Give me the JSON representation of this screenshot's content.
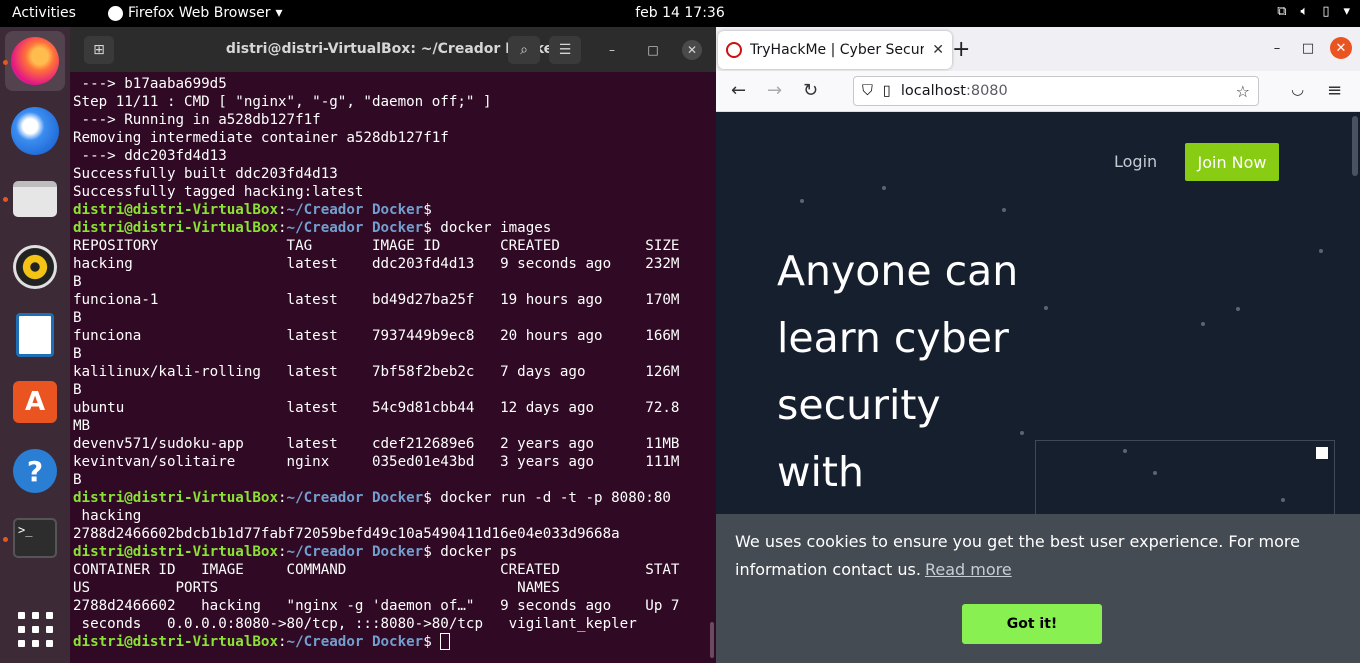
{
  "topbar": {
    "activities": "Activities",
    "app_name": "Firefox Web Browser",
    "clock": "feb 14  17:36",
    "tray_icons": [
      "network-icon",
      "volume-icon",
      "battery-icon",
      "power-menu-icon"
    ]
  },
  "dock": {
    "items": [
      "firefox",
      "thunderbird",
      "files",
      "rhythmbox",
      "libreoffice-writer",
      "software-center",
      "help",
      "terminal",
      "show-applications"
    ]
  },
  "terminal": {
    "title": "distri@distri-VirtualBox: ~/Creador Docker",
    "prompt_user": "distri@distri-VirtualBox",
    "prompt_path": "~/Creador Docker",
    "lines": [
      " ---> b17aaba699d5",
      "Step 11/11 : CMD [ \"nginx\", \"-g\", \"daemon off;\" ]",
      " ---> Running in a528db127f1f",
      "Removing intermediate container a528db127f1f",
      " ---> ddc203fd4d13",
      "Successfully built ddc203fd4d13",
      "Successfully tagged hacking:latest",
      {
        "prompt": true,
        "cmd": ""
      },
      {
        "prompt": true,
        "cmd": " docker images"
      },
      "REPOSITORY               TAG       IMAGE ID       CREATED          SIZE",
      "hacking                  latest    ddc203fd4d13   9 seconds ago    232M",
      "B",
      "funciona-1               latest    bd49d27ba25f   19 hours ago     170M",
      "B",
      "funciona                 latest    7937449b9ec8   20 hours ago     166M",
      "B",
      "kalilinux/kali-rolling   latest    7bf58f2beb2c   7 days ago       126M",
      "B",
      "ubuntu                   latest    54c9d81cbb44   12 days ago      72.8",
      "MB",
      "devenv571/sudoku-app     latest    cdef212689e6   2 years ago      11MB",
      "kevintvan/solitaire      nginx     035ed01e43bd   3 years ago      111M",
      "B",
      {
        "prompt": true,
        "cmd": " docker run -d -t -p 8080:80"
      },
      " hacking",
      "2788d2466602bdcb1b1d77fabf72059befd49c10a5490411d16e04e033d9668a",
      {
        "prompt": true,
        "cmd": " docker ps"
      },
      "CONTAINER ID   IMAGE     COMMAND                  CREATED          STAT",
      "US          PORTS                                   NAMES",
      "2788d2466602   hacking   \"nginx -g 'daemon of…\"   9 seconds ago    Up 7",
      " seconds   0.0.0.0:8080->80/tcp, :::8080->80/tcp   vigilant_kepler",
      {
        "prompt": true,
        "cmd": " ",
        "cursor": true
      }
    ]
  },
  "firefox": {
    "tab_title": "TryHackMe | Cyber Securi",
    "url_host": "localhost",
    "url_port": ":8080",
    "page": {
      "login": "Login",
      "join": "Join Now",
      "hero_lines": [
        "Anyone can",
        "learn cyber",
        "security",
        "with"
      ]
    },
    "cookie": {
      "text": "We uses cookies to ensure you get the best user experience. For more information contact us.",
      "link": "Read more",
      "button": "Got it!"
    }
  }
}
